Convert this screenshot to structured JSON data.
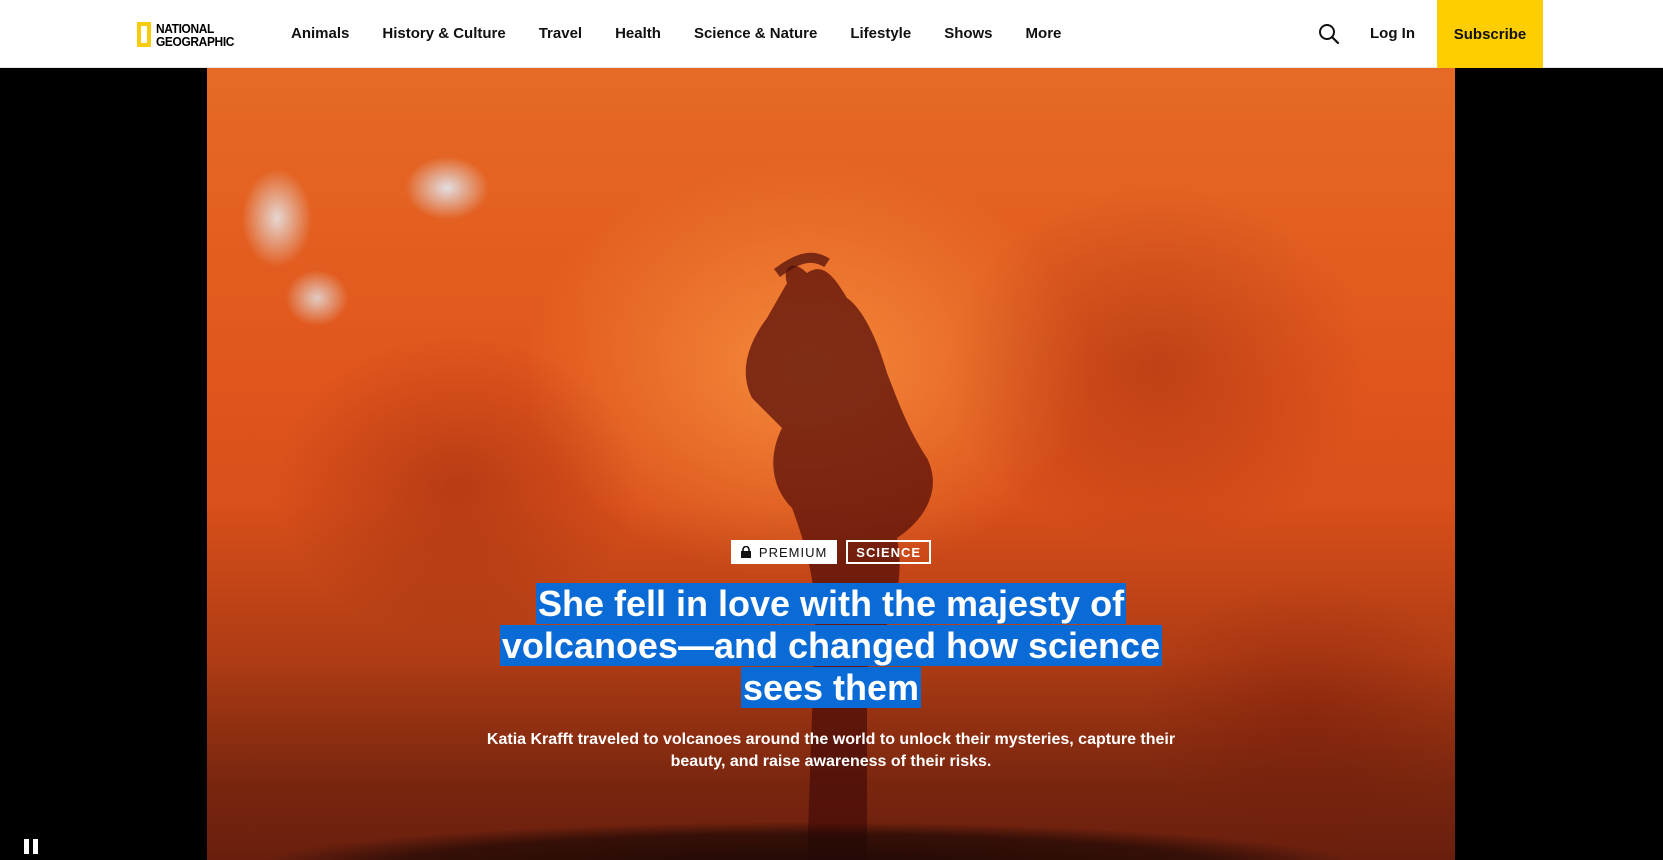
{
  "header": {
    "logo_line1": "NATIONAL",
    "logo_line2": "GEOGRAPHIC",
    "nav": [
      "Animals",
      "History & Culture",
      "Travel",
      "Health",
      "Science & Nature",
      "Lifestyle",
      "Shows",
      "More"
    ],
    "login_label": "Log In",
    "subscribe_label": "Subscribe"
  },
  "hero": {
    "tag_premium": "PREMIUM",
    "tag_category": "SCIENCE",
    "headline": "She fell in love with the majesty of volcanoes—and changed how science sees them",
    "dek": "Katia Krafft traveled to volcanoes around the world to unlock their mysteries, capture their beauty, and raise awareness of their risks."
  },
  "colors": {
    "accent_yellow": "#ffce00",
    "selection_blue": "#0a6bd6"
  },
  "icons": {
    "search": "search-icon",
    "lock": "lock-icon",
    "pause": "pause-icon"
  }
}
